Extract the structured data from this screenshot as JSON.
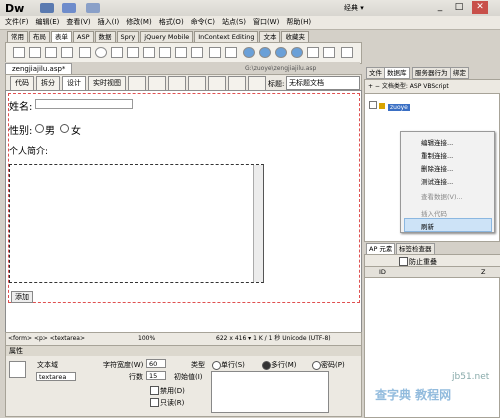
{
  "app": {
    "logo": "Dw",
    "workspace": "经典 ▾"
  },
  "menu": [
    "文件(F)",
    "编辑(E)",
    "查看(V)",
    "插入(I)",
    "修改(M)",
    "格式(O)",
    "命令(C)",
    "站点(S)",
    "窗口(W)",
    "帮助(H)"
  ],
  "insert_tabs": [
    "常用",
    "布局",
    "表单",
    "ASP",
    "数据",
    "Spry",
    "jQuery Mobile",
    "InContext Editing",
    "文本",
    "收藏夹"
  ],
  "document": {
    "tab": "zengjiajilu.asp*",
    "path": "G:\\zuoye\\zengjiajilu.asp"
  },
  "view_buttons": {
    "code": "代码",
    "split": "拆分",
    "design": "设计",
    "live": "实时视图"
  },
  "title_label": "标题:",
  "title_value": "无标题文档",
  "form": {
    "name_label": "姓名:",
    "gender_label": "性别:",
    "male": "男",
    "female": "女",
    "intro_label": "个人简介:",
    "add_button": "添加"
  },
  "status": {
    "tags": "<form> <p> <textarea>",
    "zoom": "100%",
    "size": "622 x 416 ▾ 1 K / 1 秒 Unicode (UTF-8)"
  },
  "properties": {
    "header": "属性",
    "textfield_label": "文本域",
    "textfield_name": "textarea",
    "char_width_label": "字符宽度(W)",
    "char_width": "60",
    "rows_label": "行数",
    "rows": "15",
    "type_label": "类型",
    "single": "单行(S)",
    "multi": "多行(M)",
    "password": "密码(P)",
    "init_label": "初始值(I)",
    "disabled": "禁用(D)",
    "readonly": "只读(R)"
  },
  "right_panel": {
    "tabs": [
      "文件",
      "数据库",
      "服务器行为",
      "绑定"
    ],
    "doc_type": "+ − 文档类型: ASP VBScript",
    "db_item": "zuoye",
    "context_menu": [
      "编辑连接...",
      "重制连接...",
      "删除连接...",
      "测试连接...",
      "查看数据(V)...",
      "插入代码",
      "刷新"
    ],
    "ap_tabs": [
      "AP 元素",
      "标签检查器"
    ],
    "prevent_overlap": "防止重叠",
    "ap_cols": [
      "ID",
      "Z"
    ]
  },
  "watermark": {
    "text": "查字典 教程网",
    "site": "jb51.net"
  }
}
